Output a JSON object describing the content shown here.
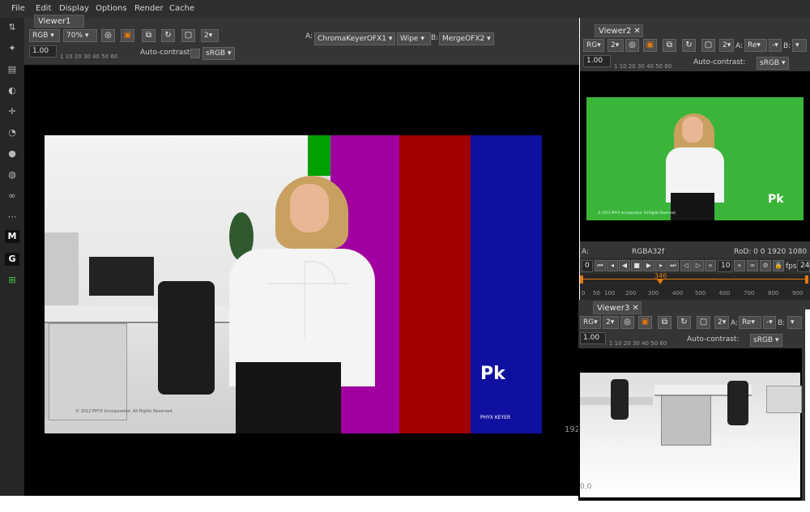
{
  "menubar": {
    "items": [
      "File",
      "Edit",
      "Display",
      "Options",
      "Render",
      "Cache"
    ]
  },
  "tools": [
    "M",
    "G"
  ],
  "viewer1": {
    "tab": "Viewer1",
    "channels": "RGB",
    "zoom": "70%",
    "layer_count": "2",
    "a_label": "A:",
    "a_input": "ChromaKeyerOFX1",
    "compare_mode": "Wipe",
    "b_label": "B:",
    "b_input": "MergeOFX2",
    "gain": "1.00",
    "ruler": "1 10 20 30 40 50 60",
    "autocontrast_label": "Auto-contrast:",
    "colorspace": "sRGB",
    "corner_value": "192",
    "image": {
      "copyright": "© 2012 PHYX Incorporated. All Rights Reserved.",
      "logo_mark": "Pk",
      "logo_text": "PHYX KEYER",
      "bar_colors": [
        "#00a000",
        "#a000a0",
        "#a00000",
        "#1010a0"
      ]
    }
  },
  "viewer2": {
    "tab": "Viewer2",
    "channels": "RG",
    "layer_count": "2",
    "count2": "2",
    "a_label": "A:",
    "a_input": "Re",
    "b_label": "B:",
    "gain": "1.00",
    "ruler": "1 10 20 30 40 50 60",
    "autocontrast_label": "Auto-contrast:",
    "colorspace": "sRGB",
    "image": {
      "bg_color": "#3ab53a",
      "copyright": "© 2012 PHYX Incorporated. All Rights Reserved.",
      "logo_mark": "Pk"
    },
    "info_a": "A:",
    "info_format": "RGBA32f",
    "info_rod": "RoD: 0 0 1920 1080"
  },
  "timeline": {
    "start_frame": "0",
    "step_value": "10",
    "fps_label": "fps",
    "fps_value": "24",
    "current_frame": "346",
    "ticks": [
      "0",
      "50",
      "100",
      "200",
      "300",
      "400",
      "500",
      "600",
      "700",
      "800",
      "900"
    ]
  },
  "viewer3": {
    "tab": "Viewer3",
    "channels": "RG",
    "layer_count": "2",
    "count2": "2",
    "a_label": "A:",
    "a_input": "Re",
    "b_label": "B:",
    "gain": "1.00",
    "ruler": "1 10 20 30 40 50 60",
    "autocontrast_label": "Auto-contrast:",
    "colorspace": "sRGB",
    "origin": "0,0"
  },
  "colors": {
    "accent": "#e07a10",
    "panel": "#353535",
    "menubar": "#2e2e2e"
  }
}
